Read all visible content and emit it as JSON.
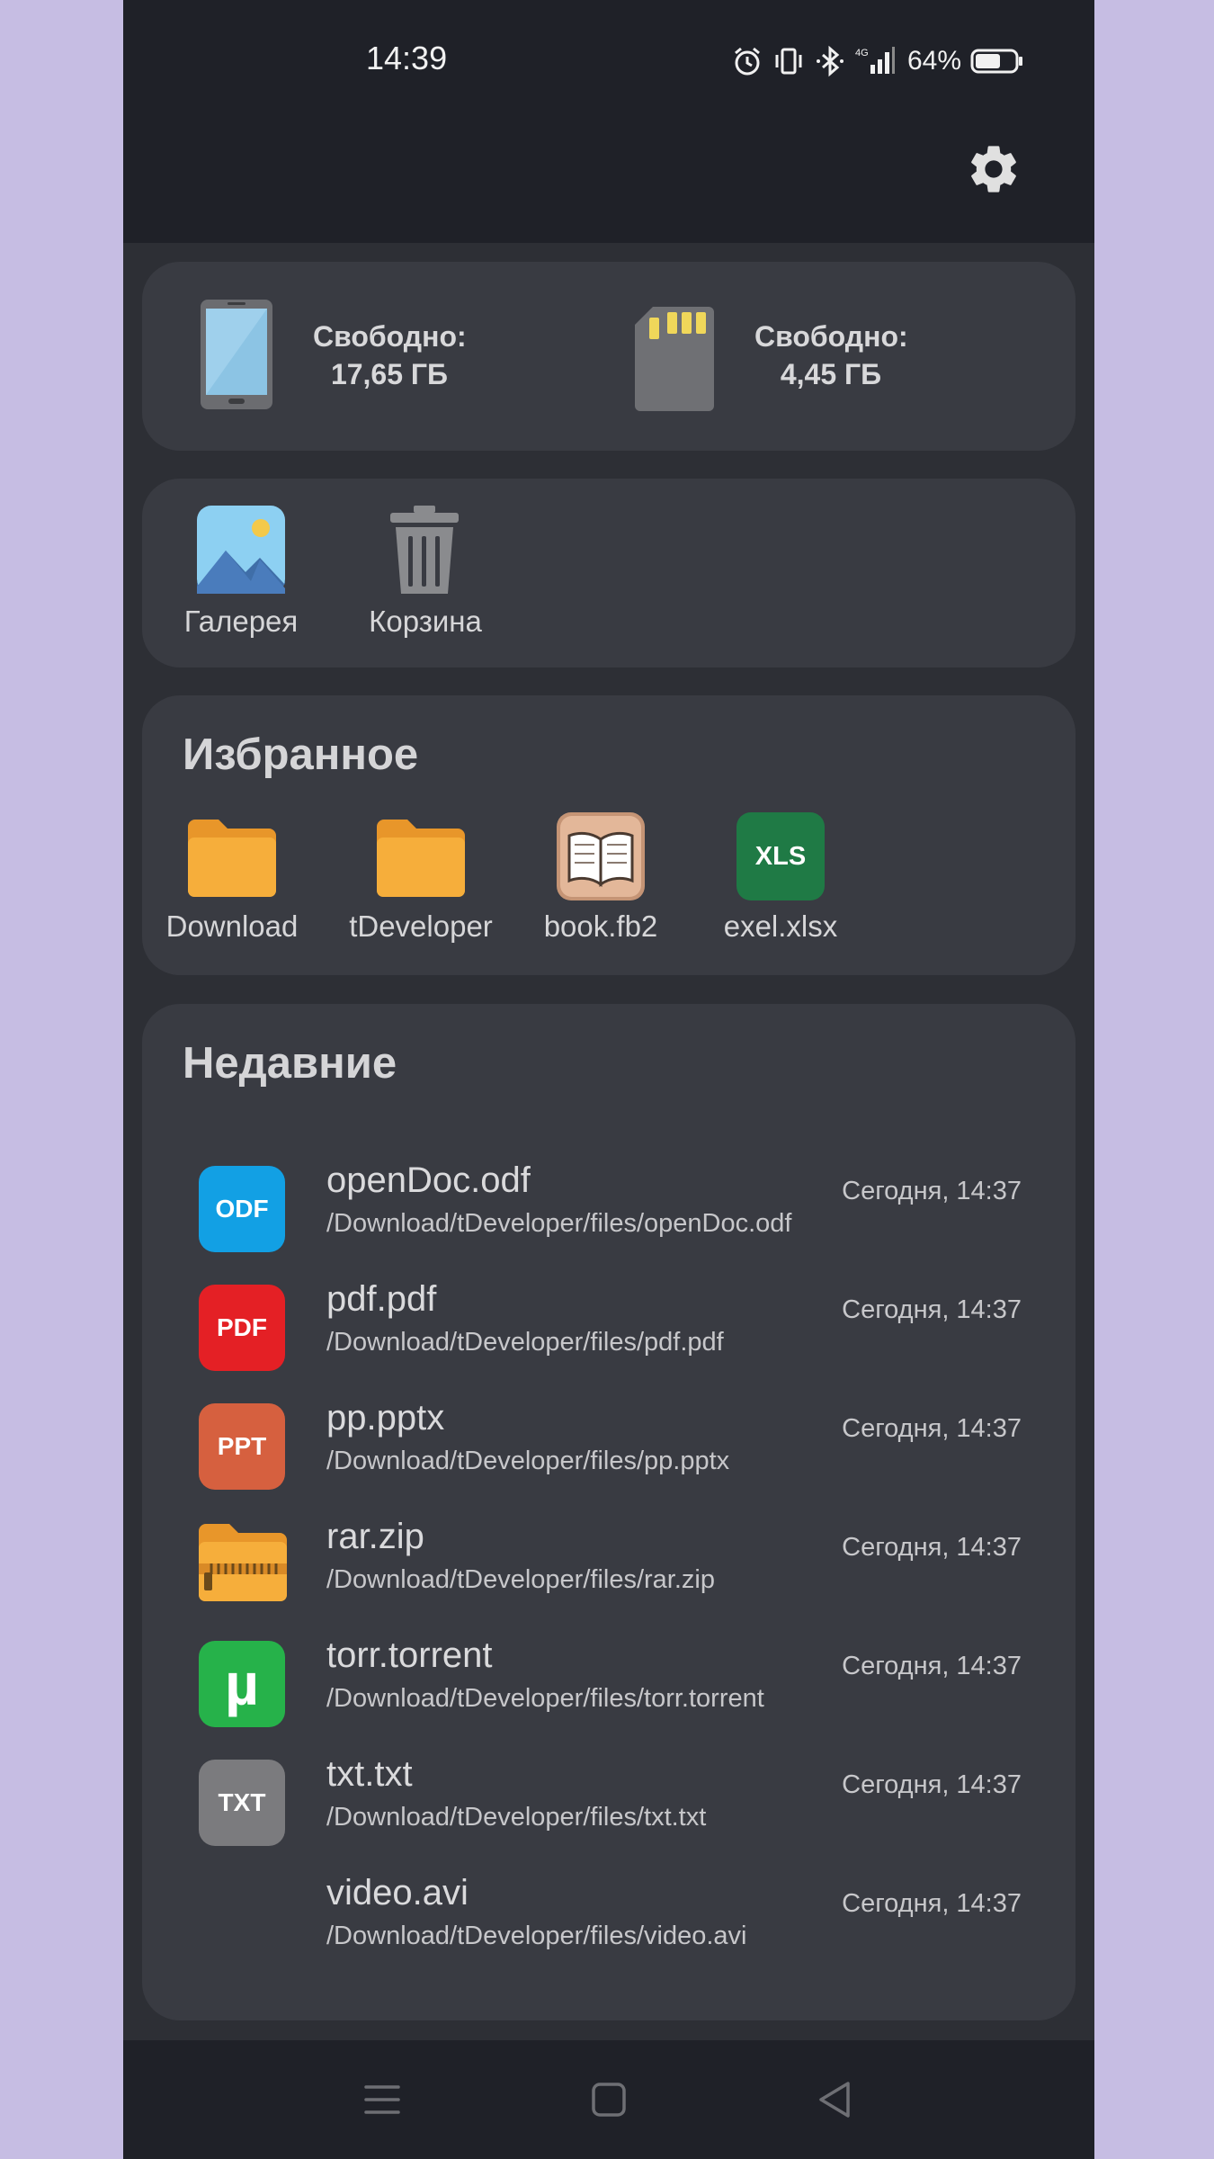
{
  "status_bar": {
    "time": "14:39",
    "network": "4G",
    "battery_percent": "64%",
    "battery_level": 0.64
  },
  "header": {
    "settings_icon": "gear-icon"
  },
  "storage": {
    "internal": {
      "label": "Свободно:",
      "value": "17,65 ГБ",
      "icon": "phone-icon"
    },
    "sd_card": {
      "label": "Свободно:",
      "value": "4,45 ГБ",
      "icon": "sd-card-icon"
    }
  },
  "quick_access": [
    {
      "label": "Галерея",
      "icon": "gallery-icon"
    },
    {
      "label": "Корзина",
      "icon": "trash-icon"
    }
  ],
  "favorites": {
    "title": "Избранное",
    "items": [
      {
        "label": "Download",
        "icon": "folder-icon"
      },
      {
        "label": "tDeveloper",
        "icon": "folder-icon"
      },
      {
        "label": "book.fb2",
        "icon": "book-icon"
      },
      {
        "label": "exel.xlsx",
        "icon": "xls-icon",
        "badge": "XLS"
      }
    ]
  },
  "recent": {
    "title": "Недавние",
    "items": [
      {
        "name": "openDoc.odf",
        "path": "/Download/tDeveloper/files/openDoc.odf",
        "date": "Сегодня, 14:37",
        "badge": "ODF",
        "color": "#12a0e4"
      },
      {
        "name": "pdf.pdf",
        "path": "/Download/tDeveloper/files/pdf.pdf",
        "date": "Сегодня, 14:37",
        "badge": "PDF",
        "color": "#e42025"
      },
      {
        "name": "pp.pptx",
        "path": "/Download/tDeveloper/files/pp.pptx",
        "date": "Сегодня, 14:37",
        "badge": "PPT",
        "color": "#d6603f"
      },
      {
        "name": "rar.zip",
        "path": "/Download/tDeveloper/files/rar.zip",
        "date": "Сегодня, 14:37",
        "badge": "",
        "color": ""
      },
      {
        "name": "torr.torrent",
        "path": "/Download/tDeveloper/files/torr.torrent",
        "date": "Сегодня, 14:37",
        "badge": "µ",
        "color": "#26b24a"
      },
      {
        "name": "txt.txt",
        "path": "/Download/tDeveloper/files/txt.txt",
        "date": "Сегодня, 14:37",
        "badge": "TXT",
        "color": "#7b7b7e"
      },
      {
        "name": "video.avi",
        "path": "/Download/tDeveloper/files/video.avi",
        "date": "Сегодня, 14:37",
        "badge": "",
        "color": ""
      }
    ]
  },
  "colors": {
    "background": "#2d2f35",
    "card": "#393b42",
    "bar": "#1f2128",
    "folder": "#f6a935"
  }
}
